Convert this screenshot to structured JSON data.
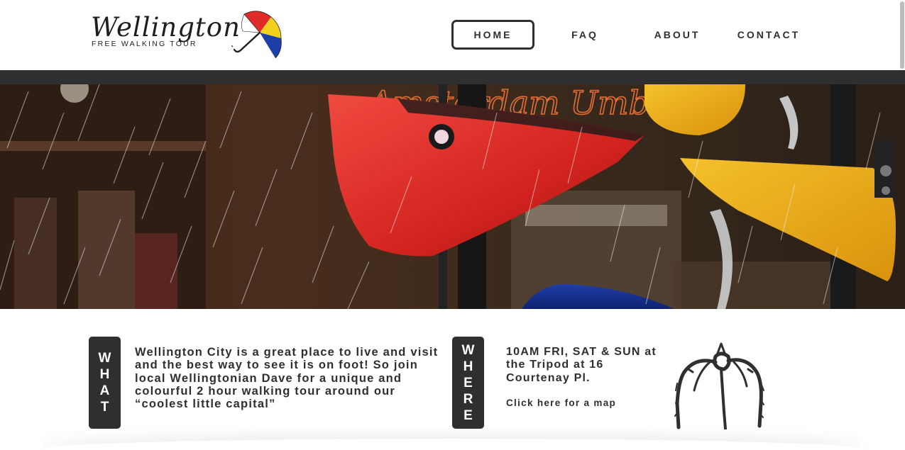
{
  "brand": {
    "wordmark": "Wellington",
    "tagline": "FREE WALKING TOUR",
    "umbrella_colors": [
      "#e02b2b",
      "#f2d01e",
      "#1f3fa8",
      "#ffffff"
    ]
  },
  "nav": {
    "items": [
      {
        "label": "HOME",
        "active": true
      },
      {
        "label": "FAQ",
        "active": false
      },
      {
        "label": "ABOUT",
        "active": false
      },
      {
        "label": "CONTACT",
        "active": false
      }
    ]
  },
  "hero": {
    "image": "rain-on-colourful-bucket-fountain"
  },
  "what": {
    "tag": [
      "W",
      "H",
      "A",
      "T"
    ],
    "text": "Wellington City is a great place to live and visit and the best way to see it is on foot! So join local Wellingtonian Dave for a unique and colourful 2 hour walking tour around our “coolest little capital”"
  },
  "where": {
    "tag": [
      "W",
      "H",
      "E",
      "R",
      "E"
    ],
    "text": "10AM FRI, SAT & SUN at the Tripod at 16 Courtenay Pl.",
    "map_link": "Click here for a map"
  },
  "colors": {
    "dark": "#2f2f2f",
    "background": "#ffffff"
  },
  "icons": {
    "logo_umbrella": "umbrella-icon",
    "tripod": "tripod-sculpture-icon"
  }
}
